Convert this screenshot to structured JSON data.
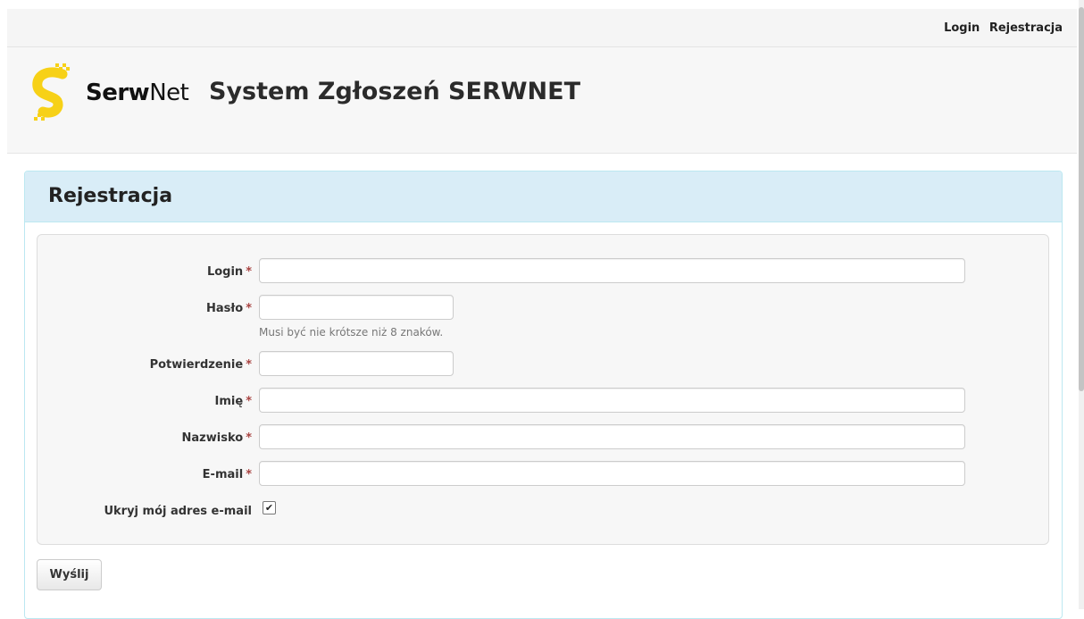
{
  "topnav": {
    "login": "Login",
    "register": "Rejestracja"
  },
  "header": {
    "brand_bold": "Serw",
    "brand_light": "Net",
    "title": "System Zgłoszeń SERWNET",
    "logo_color": "#f7d117"
  },
  "panel": {
    "title": "Rejestracja"
  },
  "form": {
    "required_mark": "*",
    "login_label": "Login",
    "password_label": "Hasło",
    "password_help": "Musi być nie krótsze niż 8 znaków.",
    "confirm_label": "Potwierdzenie",
    "firstname_label": "Imię",
    "lastname_label": "Nazwisko",
    "email_label": "E-mail",
    "hide_email_label": "Ukryj mój adres e-mail",
    "hide_email_checked": true,
    "checkmark": "✔",
    "submit_label": "Wyślij"
  }
}
